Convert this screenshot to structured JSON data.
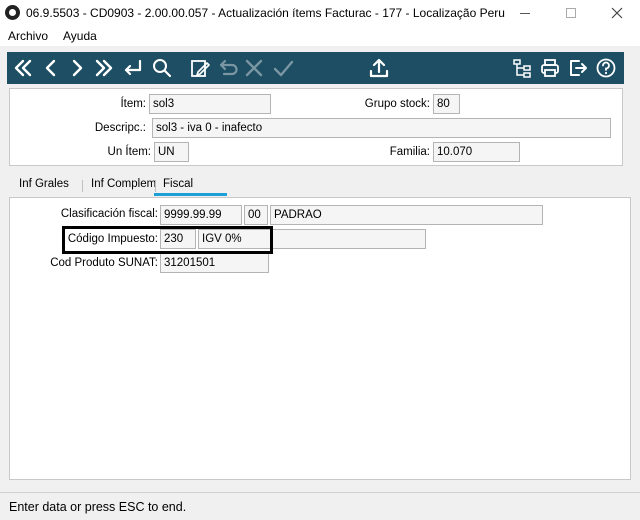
{
  "window": {
    "title": "06.9.5503 - CD0903 - 2.00.00.057 - Actualización ítems Facturac - 177 - Localização Peru"
  },
  "menu": {
    "archivo": "Archivo",
    "ayuda": "Ayuda"
  },
  "toolbar": {
    "background": "#1d4e63",
    "icons": [
      "first-icon",
      "previous-icon",
      "next-icon",
      "last-icon",
      "return-icon",
      "search-icon",
      "edit-icon",
      "undo-icon",
      "cancel-icon",
      "confirm-icon",
      "export-icon",
      "hierarchy-icon",
      "print-icon",
      "exit-icon",
      "help-icon"
    ]
  },
  "header": {
    "item_label": "Ítem:",
    "item_value": "sol3",
    "grupo_stock_label": "Grupo stock:",
    "grupo_stock_value": "80",
    "descripc_label": "Descripc.:",
    "descripc_value": "sol3 -  iva 0 - inafecto",
    "un_item_label": "Un Ítem:",
    "un_item_value": "UN",
    "familia_label": "Familia:",
    "familia_value": "10.070"
  },
  "tabs": {
    "inf_grales": "Inf Grales",
    "inf_complem": "Inf Complem",
    "fiscal": "Fiscal",
    "active": "Fiscal",
    "active_color": "#1ca0d6"
  },
  "fiscal": {
    "clasificacion_label": "Clasificación fiscal:",
    "clasificacion_value": "9999.99.99",
    "clasificacion_code": "00",
    "clasificacion_desc": "PADRAO",
    "codigo_impuesto_label": "Código Impuesto:",
    "codigo_impuesto_value": "230",
    "codigo_impuesto_desc": "IGV 0%",
    "cod_produto_label": "Cod Produto SUNAT:",
    "cod_produto_value": "31201501"
  },
  "status": {
    "text": "Enter data or press ESC to end."
  }
}
